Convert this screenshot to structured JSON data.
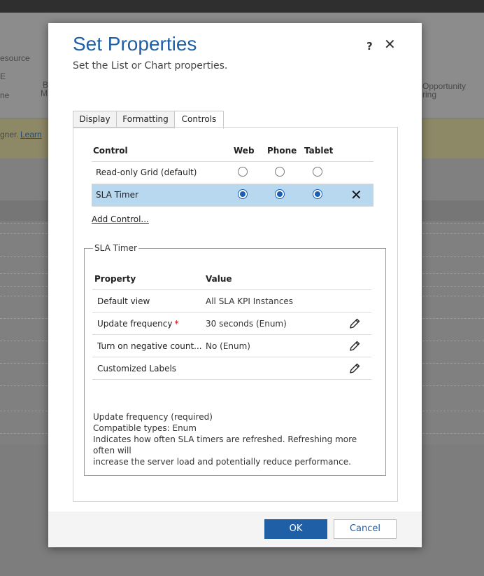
{
  "background": {
    "left_items": [
      "esource",
      "E",
      "ne"
    ],
    "ribbon_snippets": [
      "B",
      "M"
    ],
    "right_item": [
      "Opportunity",
      "ring"
    ],
    "notice_text": "gner.",
    "notice_link": "Learn"
  },
  "dialog": {
    "title": "Set Properties",
    "subtitle": "Set the List or Chart properties.",
    "help_label": "?",
    "close_label": "✕"
  },
  "tabs": [
    {
      "label": "Display",
      "active": false
    },
    {
      "label": "Formatting",
      "active": false
    },
    {
      "label": "Controls",
      "active": true
    }
  ],
  "controls_table": {
    "headers": {
      "control": "Control",
      "web": "Web",
      "phone": "Phone",
      "tablet": "Tablet"
    },
    "rows": [
      {
        "name": "Read-only Grid (default)",
        "web": false,
        "phone": false,
        "tablet": false,
        "selected": false
      },
      {
        "name": "SLA Timer",
        "web": true,
        "phone": true,
        "tablet": true,
        "selected": true,
        "remove_label": "✕"
      }
    ],
    "add_control": "Add Control..."
  },
  "sla_timer": {
    "legend": "SLA Timer",
    "headers": {
      "property": "Property",
      "value": "Value"
    },
    "rows": [
      {
        "property": "Default view",
        "value": "All SLA KPI Instances",
        "required": false,
        "editable": false
      },
      {
        "property": "Update frequency",
        "value": "30 seconds (Enum)",
        "required": true,
        "editable": true
      },
      {
        "property": "Turn on negative count...",
        "value": "No (Enum)",
        "required": false,
        "editable": true
      },
      {
        "property": "Customized Labels",
        "value": "",
        "required": false,
        "editable": true
      }
    ],
    "required_marker": "*",
    "description": [
      "Update frequency (required)",
      "Compatible types: Enum",
      "Indicates how often SLA timers are refreshed. Refreshing more often will",
      "increase the server load and potentially reduce performance."
    ]
  },
  "footer": {
    "ok_label": "OK",
    "cancel_label": "Cancel"
  },
  "colors": {
    "accent": "#1f5fa6",
    "selected_row": "#b8d8f0",
    "required": "#cc0000"
  }
}
